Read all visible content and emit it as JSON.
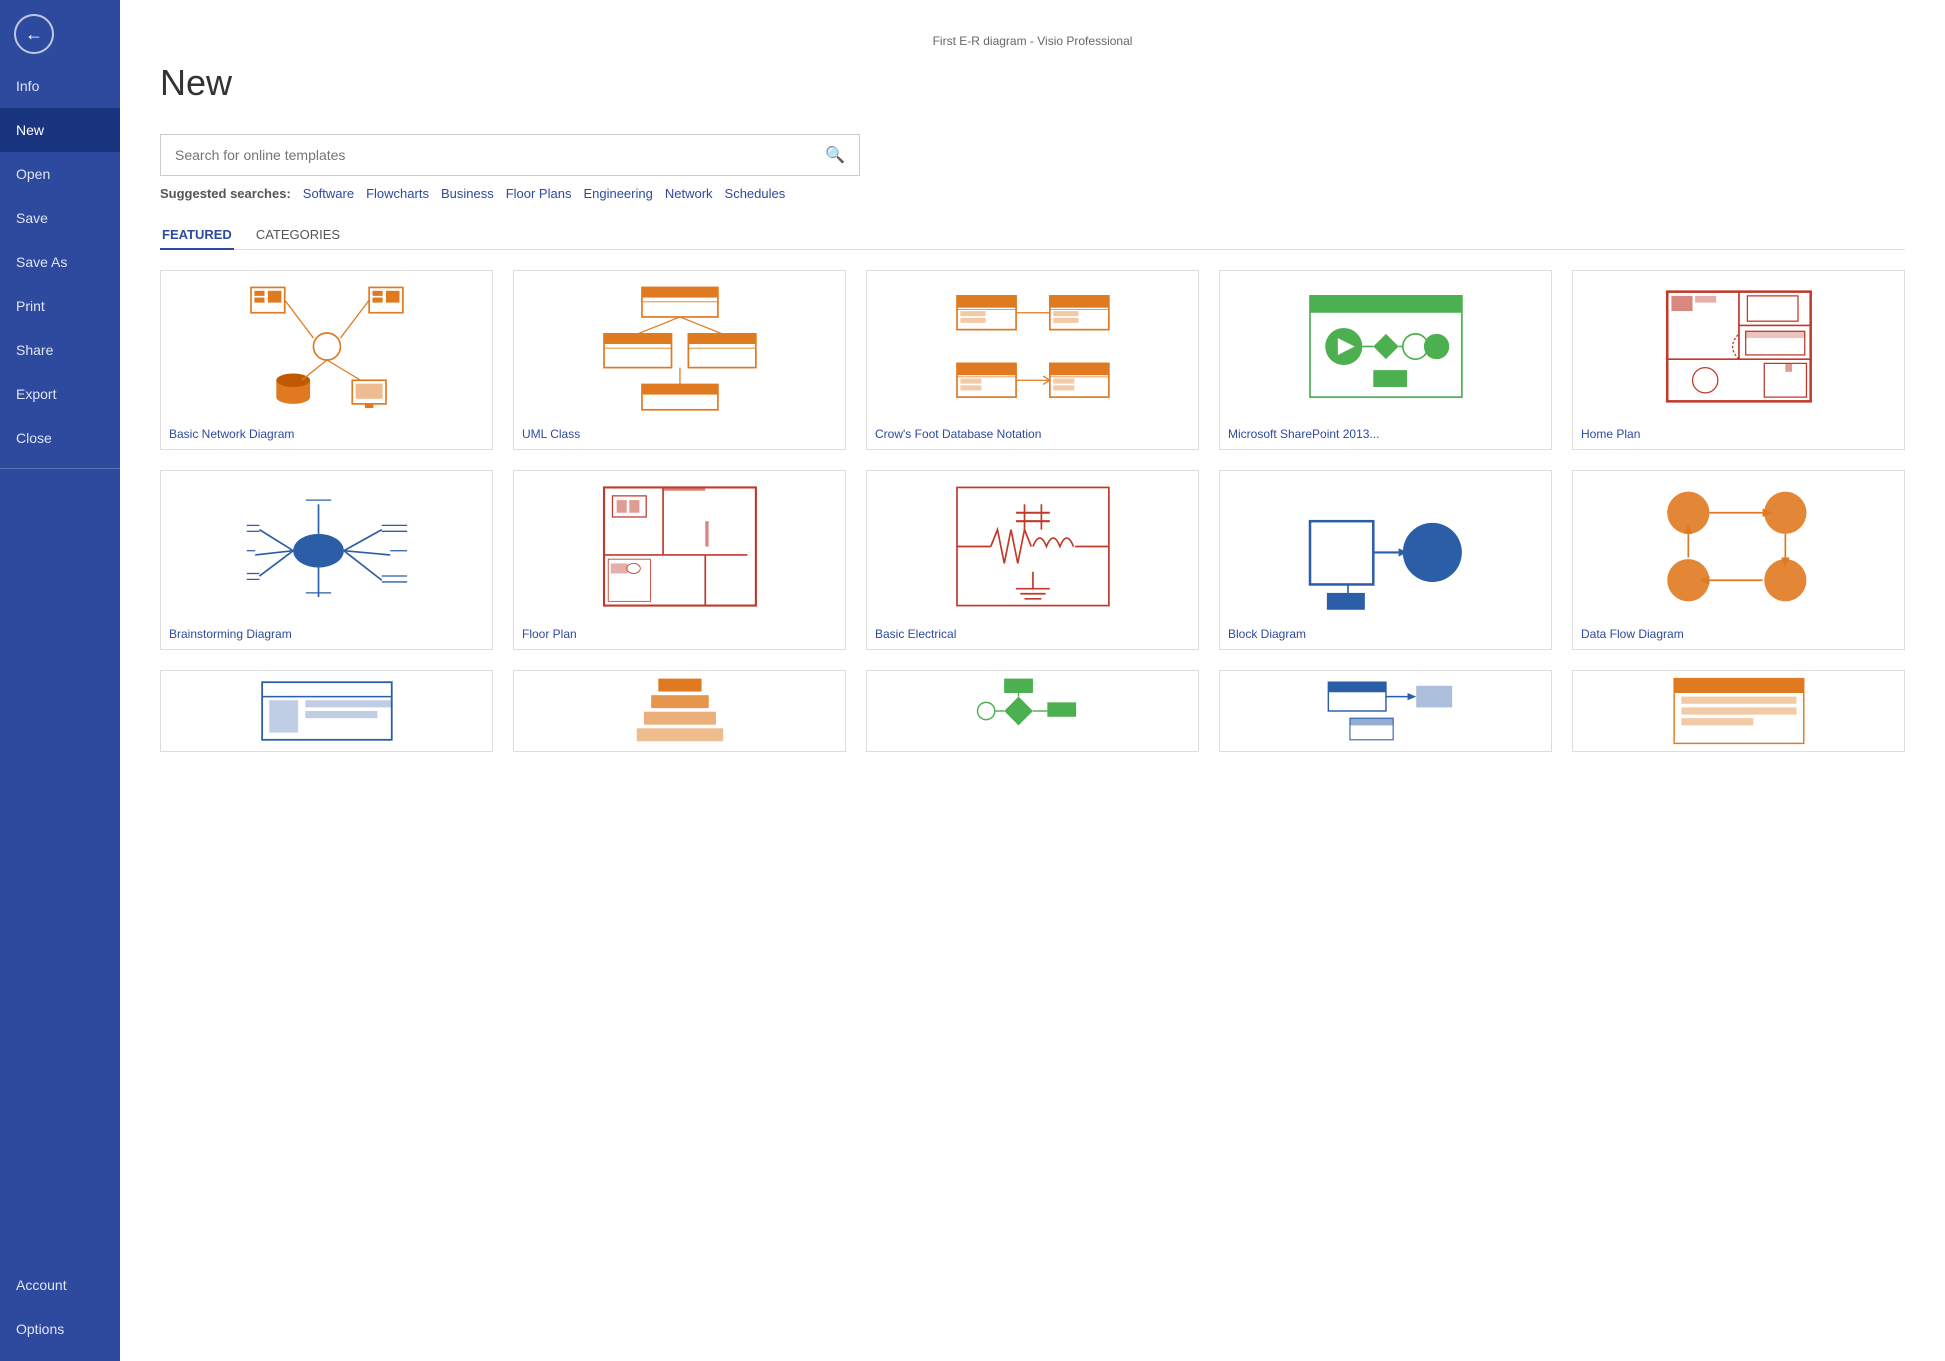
{
  "window": {
    "title": "First E-R diagram - Visio Professional"
  },
  "sidebar": {
    "back_icon": "←",
    "items": [
      {
        "id": "info",
        "label": "Info",
        "active": false
      },
      {
        "id": "new",
        "label": "New",
        "active": true
      },
      {
        "id": "open",
        "label": "Open",
        "active": false
      },
      {
        "id": "save",
        "label": "Save",
        "active": false
      },
      {
        "id": "save-as",
        "label": "Save As",
        "active": false
      },
      {
        "id": "print",
        "label": "Print",
        "active": false
      },
      {
        "id": "share",
        "label": "Share",
        "active": false
      },
      {
        "id": "export",
        "label": "Export",
        "active": false
      },
      {
        "id": "close",
        "label": "Close",
        "active": false
      }
    ],
    "bottom_items": [
      {
        "id": "account",
        "label": "Account"
      },
      {
        "id": "options",
        "label": "Options"
      }
    ]
  },
  "main": {
    "page_title": "New",
    "search": {
      "placeholder": "Search for online templates",
      "icon": "🔍"
    },
    "suggested": {
      "label": "Suggested searches:",
      "links": [
        "Software",
        "Flowcharts",
        "Business",
        "Floor Plans",
        "Engineering",
        "Network",
        "Schedules"
      ]
    },
    "tabs": [
      {
        "id": "featured",
        "label": "FEATURED",
        "active": true
      },
      {
        "id": "categories",
        "label": "CATEGORIES",
        "active": false
      }
    ],
    "templates_row1": [
      {
        "id": "basic-network",
        "label": "Basic Network Diagram"
      },
      {
        "id": "uml-class",
        "label": "UML Class"
      },
      {
        "id": "crows-foot",
        "label": "Crow's Foot Database Notation"
      },
      {
        "id": "sharepoint",
        "label": "Microsoft SharePoint 2013..."
      },
      {
        "id": "home-plan",
        "label": "Home Plan"
      }
    ],
    "templates_row2": [
      {
        "id": "brainstorming",
        "label": "Brainstorming Diagram"
      },
      {
        "id": "floor-plan",
        "label": "Floor Plan"
      },
      {
        "id": "basic-electrical",
        "label": "Basic Electrical"
      },
      {
        "id": "block-diagram",
        "label": "Block Diagram"
      },
      {
        "id": "data-flow",
        "label": "Data Flow Diagram"
      }
    ]
  }
}
